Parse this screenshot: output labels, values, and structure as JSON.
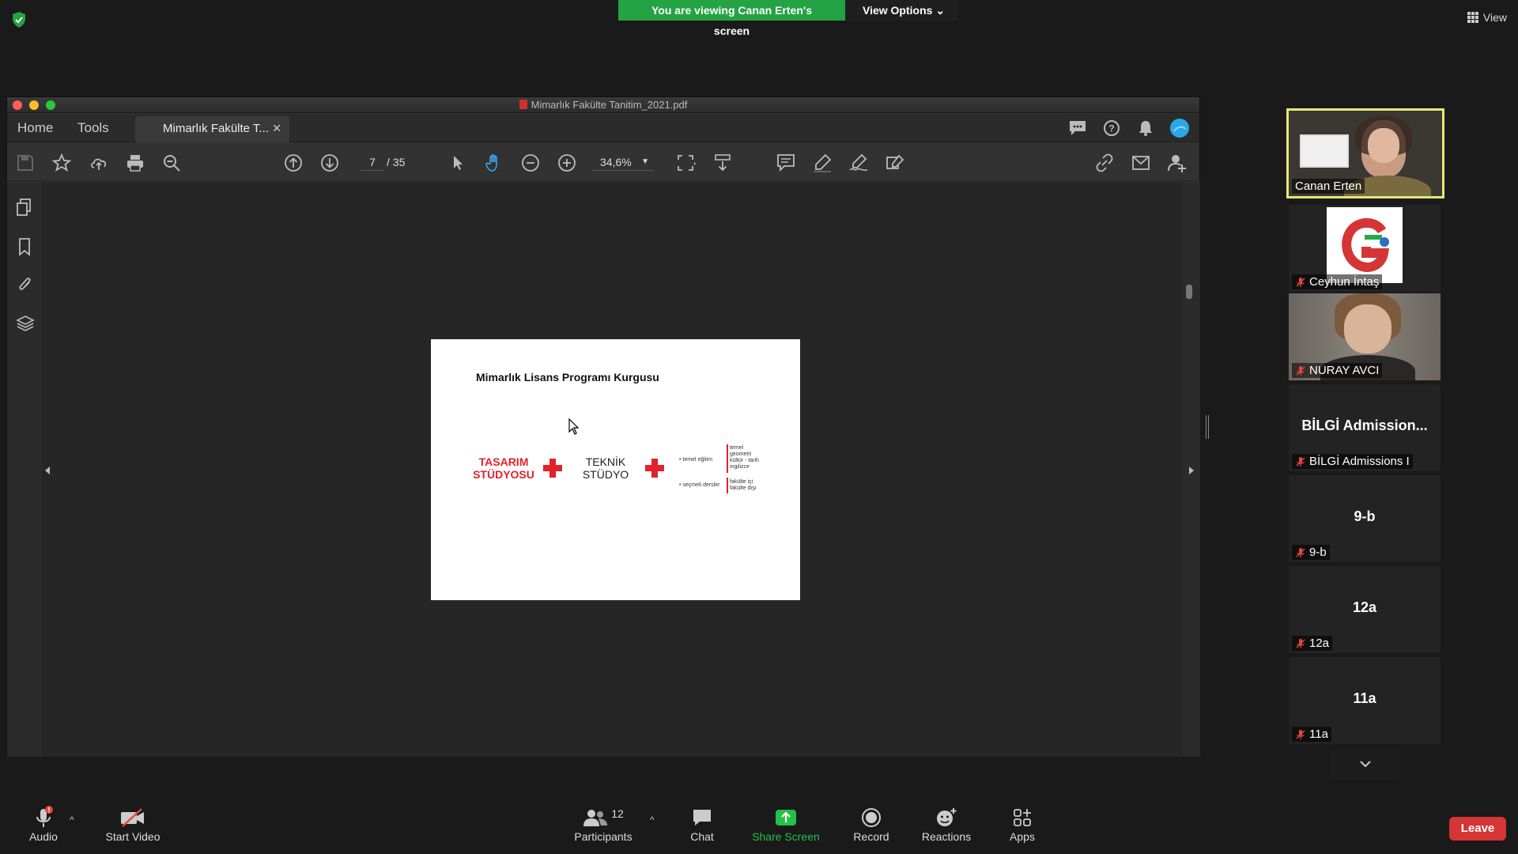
{
  "zoom_meeting": {
    "share_banner": "You are viewing Canan Erten's screen",
    "view_options": "View Options",
    "view_label": "View"
  },
  "acrobat": {
    "window_title": "Mimarlık Fakülte Tanitim_2021.pdf",
    "menu": {
      "home": "Home",
      "tools": "Tools"
    },
    "doc_tab": "Mimarlık Fakülte T...",
    "page_current": "7",
    "page_total": "/ 35",
    "zoom": "34,6%",
    "pdf_page": {
      "title": "Mimarlık Lisans Programı Kurgusu",
      "block1_line1": "TASARIM",
      "block1_line2": "STÜDYOSU",
      "block2_line1": "TEKNİK",
      "block2_line2": "STÜDYO",
      "list1_left": "• temel eğitim",
      "list1_right_1": "temel",
      "list1_right_2": "geometri",
      "list1_right_3": "kültür - tarih",
      "list1_right_4": "ingilizce",
      "list2_left": "• seçmeli dersler",
      "list2_right_1": "fakülte içi",
      "list2_right_2": "fakülte dışı"
    }
  },
  "participants": [
    {
      "name": "Canan Erten",
      "type": "video",
      "active": true
    },
    {
      "name": "Ceyhun İntaş",
      "type": "logo",
      "muted": true
    },
    {
      "name": "NURAY AVCI",
      "type": "video",
      "muted": true
    },
    {
      "name": "BİLGİ Admissions I",
      "big": "BİLGİ Admission...",
      "muted": true
    },
    {
      "name": "9-b",
      "big": "9-b",
      "muted": true
    },
    {
      "name": "12a",
      "big": "12a",
      "muted": true
    },
    {
      "name": "11a",
      "big": "11a",
      "muted": true
    }
  ],
  "controls": {
    "audio": "Audio",
    "start_video": "Start Video",
    "participants": "Participants",
    "participants_count": "12",
    "chat": "Chat",
    "share_screen": "Share Screen",
    "record": "Record",
    "reactions": "Reactions",
    "apps": "Apps",
    "leave": "Leave"
  },
  "colors": {
    "zoom_green": "#23a342",
    "leave_red": "#d63535",
    "slide_red": "#e3202c",
    "active_border": "#e6e67a"
  }
}
